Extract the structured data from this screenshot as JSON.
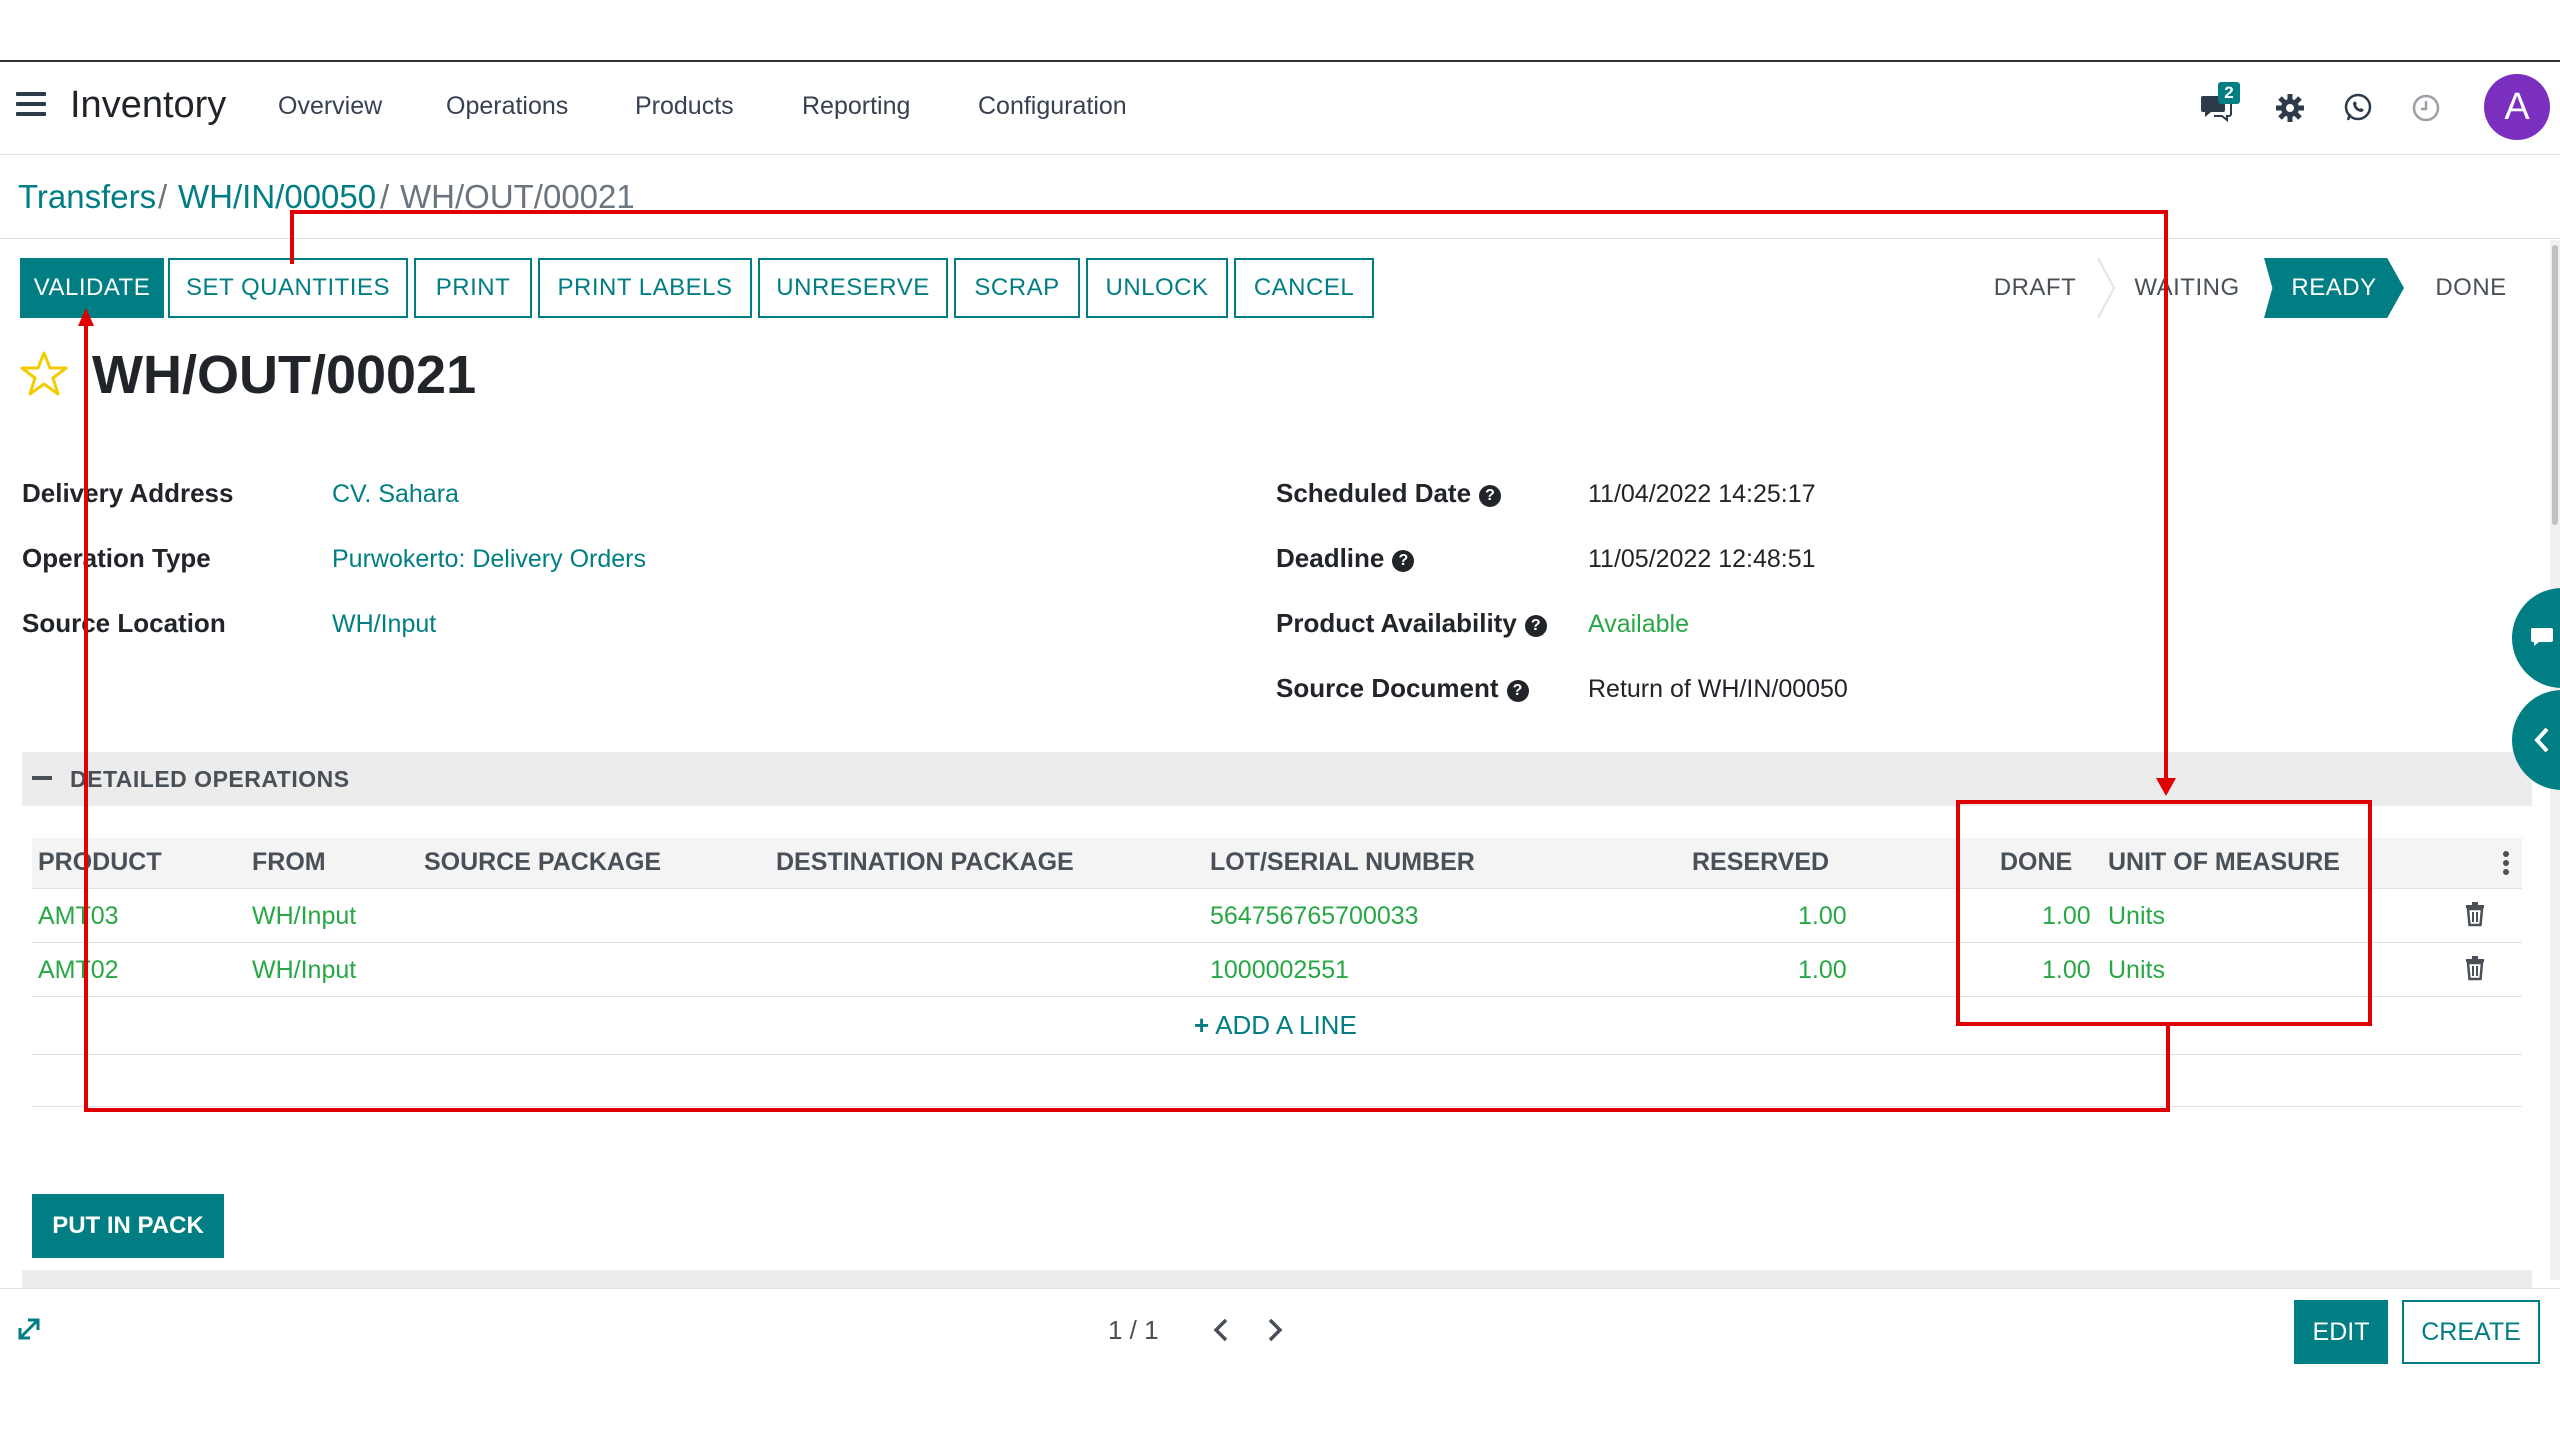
{
  "app": {
    "name": "Inventory",
    "menu": [
      "Overview",
      "Operations",
      "Products",
      "Reporting",
      "Configuration"
    ],
    "chat_badge": "2",
    "avatar_letter": "A"
  },
  "breadcrumb": {
    "items": [
      "Transfers",
      "WH/IN/00050"
    ],
    "current": "WH/OUT/00021",
    "separator": "/"
  },
  "actions": [
    "VALIDATE",
    "SET QUANTITIES",
    "PRINT",
    "PRINT LABELS",
    "UNRESERVE",
    "SCRAP",
    "UNLOCK",
    "CANCEL"
  ],
  "status_stages": [
    "DRAFT",
    "WAITING",
    "READY",
    "DONE"
  ],
  "active_stage": "READY",
  "record": {
    "title": "WH/OUT/00021"
  },
  "fields_left": [
    {
      "label": "Delivery Address",
      "value": "CV. Sahara"
    },
    {
      "label": "Operation Type",
      "value": "Purwokerto: Delivery Orders"
    },
    {
      "label": "Source Location",
      "value": "WH/Input"
    }
  ],
  "fields_right": [
    {
      "label": "Scheduled Date",
      "value": "11/04/2022 14:25:17"
    },
    {
      "label": "Deadline",
      "value": "11/05/2022 12:48:51"
    },
    {
      "label": "Product Availability",
      "value": "Available"
    },
    {
      "label": "Source Document",
      "value": "Return of WH/IN/00050"
    }
  ],
  "help_mark": "?",
  "detailed_operations": {
    "section_title": "DETAILED OPERATIONS",
    "columns": [
      "PRODUCT",
      "FROM",
      "SOURCE PACKAGE",
      "DESTINATION PACKAGE",
      "LOT/SERIAL NUMBER",
      "RESERVED",
      "DONE",
      "UNIT OF MEASURE"
    ],
    "rows": [
      {
        "product": "AMT03",
        "from": "WH/Input",
        "lot": "564756765700033",
        "reserved": "1.00",
        "done": "1.00",
        "uom": "Units"
      },
      {
        "product": "AMT02",
        "from": "WH/Input",
        "lot": "1000002551",
        "reserved": "1.00",
        "done": "1.00",
        "uom": "Units"
      }
    ],
    "add_line": "ADD A LINE"
  },
  "put_in_pack": "PUT IN PACK",
  "pager": "1 / 1",
  "bottom_buttons": {
    "edit": "EDIT",
    "create": "CREATE"
  },
  "colors": {
    "accent": "#017e84",
    "link_green": "#28a745",
    "annotation_red": "#e00000"
  }
}
